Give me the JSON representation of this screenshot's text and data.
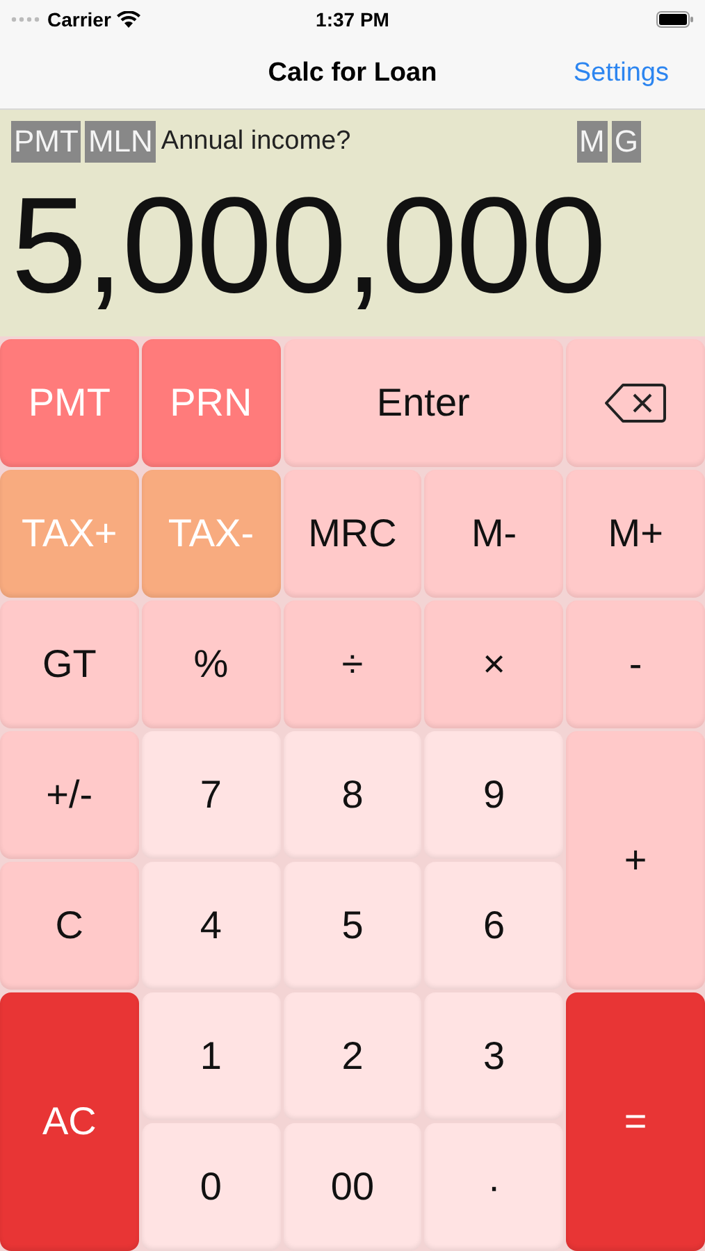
{
  "status_bar": {
    "carrier": "Carrier",
    "time": "1:37 PM"
  },
  "nav": {
    "title": "Calc for Loan",
    "action": "Settings"
  },
  "display": {
    "left_badges": [
      "PMT",
      "MLN"
    ],
    "prompt": "Annual income?",
    "right_badges": [
      "M",
      "G"
    ],
    "value": "5,000,000"
  },
  "keys": [
    {
      "label": "PMT",
      "kind": "red",
      "wide": false,
      "tall": false
    },
    {
      "label": "PRN",
      "kind": "red",
      "wide": false,
      "tall": false
    },
    {
      "label": "Enter",
      "kind": "pink",
      "wide": true,
      "tall": false
    },
    {
      "kind": "backspace",
      "wide": false,
      "tall": false
    },
    {
      "label": "TAX+",
      "kind": "orange",
      "wide": false,
      "tall": false
    },
    {
      "label": "TAX-",
      "kind": "orange",
      "wide": false,
      "tall": false
    },
    {
      "label": "MRC",
      "kind": "pink",
      "wide": false,
      "tall": false
    },
    {
      "label": "M-",
      "kind": "pink",
      "wide": false,
      "tall": false
    },
    {
      "label": "M+",
      "kind": "pink",
      "wide": false,
      "tall": false
    },
    {
      "label": "GT",
      "kind": "pink",
      "wide": false,
      "tall": false
    },
    {
      "label": "%",
      "kind": "pink",
      "wide": false,
      "tall": false
    },
    {
      "label": "÷",
      "kind": "pink",
      "wide": false,
      "tall": false
    },
    {
      "label": "×",
      "kind": "pink",
      "wide": false,
      "tall": false
    },
    {
      "label": "-",
      "kind": "pink",
      "wide": false,
      "tall": false
    },
    {
      "label": "+/-",
      "kind": "pink",
      "wide": false,
      "tall": false
    },
    {
      "label": "7",
      "kind": "light",
      "wide": false,
      "tall": false
    },
    {
      "label": "8",
      "kind": "light",
      "wide": false,
      "tall": false
    },
    {
      "label": "9",
      "kind": "light",
      "wide": false,
      "tall": false
    },
    {
      "label": "+",
      "kind": "pink",
      "wide": false,
      "tall": true
    },
    {
      "label": "C",
      "kind": "pink",
      "wide": false,
      "tall": false
    },
    {
      "label": "4",
      "kind": "light",
      "wide": false,
      "tall": false
    },
    {
      "label": "5",
      "kind": "light",
      "wide": false,
      "tall": false
    },
    {
      "label": "6",
      "kind": "light",
      "wide": false,
      "tall": false
    },
    {
      "label": "AC",
      "kind": "strong",
      "wide": false,
      "tall": true
    },
    {
      "label": "1",
      "kind": "light",
      "wide": false,
      "tall": false
    },
    {
      "label": "2",
      "kind": "light",
      "wide": false,
      "tall": false
    },
    {
      "label": "3",
      "kind": "light",
      "wide": false,
      "tall": false
    },
    {
      "label": "=",
      "kind": "strong",
      "wide": false,
      "tall": true
    },
    {
      "label": "0",
      "kind": "light",
      "wide": false,
      "tall": false
    },
    {
      "label": "00",
      "kind": "light",
      "wide": false,
      "tall": false
    },
    {
      "label": "·",
      "kind": "light",
      "wide": false,
      "tall": false
    }
  ]
}
